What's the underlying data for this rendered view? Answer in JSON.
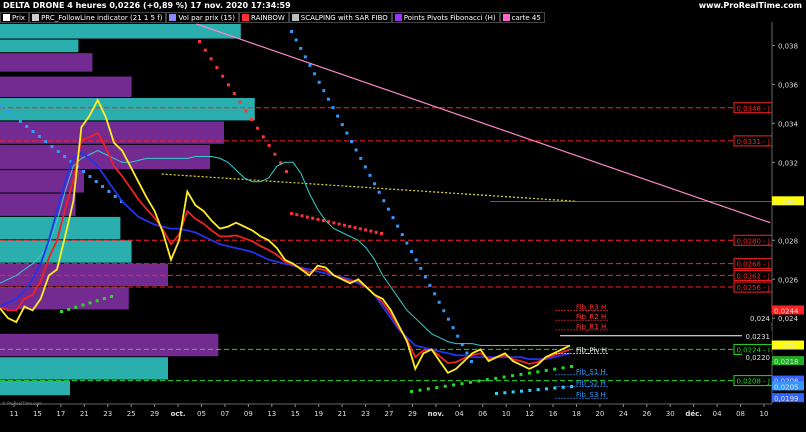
{
  "header": {
    "title": "DELTA DRONE 4 heures 0,0226 (+0,89 %) 17 nov. 2020 17:34:59",
    "brand": "www.ProRealTime.com"
  },
  "legend": [
    {
      "label": "Prix",
      "color": "#ffffff"
    },
    {
      "label": "PRC_FollowLine indicator (21 1 5 f)",
      "color": "#cccccc"
    },
    {
      "label": "Vol par prix (15)",
      "color": "#8888ff"
    },
    {
      "label": "RAINBOW",
      "color": "#ff3333"
    },
    {
      "label": "SCALPING with SAR FIBO",
      "color": "#bbbbbb"
    },
    {
      "label": "Points Pivots Fibonacci (H)",
      "color": "#9933ff"
    },
    {
      "label": "carte 45",
      "color": "#ff66cc"
    }
  ],
  "footer": "© ProRealTime.com",
  "colors": {
    "background": "#000000",
    "red_dash": "#ff2020",
    "green_dash": "#22dd22",
    "blue_dots": "#3399ff",
    "pink_trend": "#ff88cc",
    "yellow_dots": "#dddd33",
    "volume_cyan": "#33cccc",
    "volume_purple": "#8833aa"
  },
  "chart_data": {
    "type": "line",
    "title": "DELTA DRONE 4 heures",
    "ylim": [
      0.0196,
      0.0392
    ],
    "y_ticks": [
      "0,038",
      "0,036",
      "0,034",
      "0,032",
      "0,030",
      "0,028",
      "0,026",
      "0,024"
    ],
    "x_ticks": [
      "11",
      "15",
      "17",
      "21",
      "23",
      "25",
      "29",
      "oct.",
      "05",
      "07",
      "09",
      "13",
      "15",
      "19",
      "21",
      "23",
      "27",
      "29",
      "nov.",
      "04",
      "06",
      "10",
      "12",
      "16",
      "18",
      "20",
      "24",
      "26",
      "30",
      "déc.",
      "04",
      "08",
      "10"
    ],
    "red_levels": [
      {
        "label": "0,0348 - J",
        "value": 0.0348
      },
      {
        "label": "0,0331 - J",
        "value": 0.0331
      },
      {
        "label": "0,0280 - J",
        "value": 0.028
      },
      {
        "label": "0,0268 - J",
        "value": 0.0268
      },
      {
        "label": "0,0262 - J",
        "value": 0.0262
      },
      {
        "label": "0,0256 - J",
        "value": 0.0256
      }
    ],
    "green_levels": [
      {
        "label": "0,0224 - J",
        "value": 0.0224
      },
      {
        "label": "0,0208 - J",
        "value": 0.0208
      }
    ],
    "price_tags": [
      {
        "label": "0,0300",
        "value": 0.03,
        "bg": "#ffff00",
        "fg": "#000000"
      },
      {
        "label": "0,0244",
        "value": 0.0244,
        "bg": "#ff2020",
        "fg": "#ffffff"
      },
      {
        "label": "0,024",
        "value": 0.024,
        "bg": "#000000",
        "fg": "#ffffff"
      },
      {
        "label": "0,0231",
        "value": 0.0231,
        "bg": "#000000",
        "fg": "#ffffff"
      },
      {
        "label": "0,0226",
        "value": 0.0226,
        "bg": "#ffff00",
        "fg": "#000000"
      },
      {
        "label": "0,0220",
        "value": 0.022,
        "bg": "#000000",
        "fg": "#ffffff"
      },
      {
        "label": "0,0218",
        "value": 0.0218,
        "bg": "#22aa22",
        "fg": "#ffffff"
      },
      {
        "label": "0,0208",
        "value": 0.0208,
        "bg": "#3366ff",
        "fg": "#ffffff"
      },
      {
        "label": "0,0205",
        "value": 0.0205,
        "bg": "#3399ff",
        "fg": "#ffffff"
      },
      {
        "label": "0,0199",
        "value": 0.0199,
        "bg": "#3366ff",
        "fg": "#ffffff"
      }
    ],
    "fib_labels": [
      {
        "label": "Fib_R3 H",
        "value": 0.0244,
        "color": "#ff3333"
      },
      {
        "label": "Fib_R2 H",
        "value": 0.0239,
        "color": "#ff3333"
      },
      {
        "label": "Fib_R1 H",
        "value": 0.0234,
        "color": "#ff3333"
      },
      {
        "label": "Fib_Piv H",
        "value": 0.0222,
        "color": "#ffffff"
      },
      {
        "label": "Fib_S1 H",
        "value": 0.0211,
        "color": "#3399ff"
      },
      {
        "label": "Fib_S2 H",
        "value": 0.0205,
        "color": "#3399ff"
      },
      {
        "label": "Fib_S3 H",
        "value": 0.0199,
        "color": "#3399ff"
      }
    ],
    "volume_profile": [
      {
        "y_top": 0.0391,
        "y_bot": 0.0383,
        "v": 0.86,
        "c": "cyan"
      },
      {
        "y_top": 0.0383,
        "y_bot": 0.0376,
        "v": 0.28,
        "c": "cyan"
      },
      {
        "y_top": 0.0376,
        "y_bot": 0.0366,
        "v": 0.33,
        "c": "purple"
      },
      {
        "y_top": 0.0364,
        "y_bot": 0.0353,
        "v": 0.47,
        "c": "purple"
      },
      {
        "y_top": 0.0353,
        "y_bot": 0.0341,
        "v": 0.91,
        "c": "cyan"
      },
      {
        "y_top": 0.0341,
        "y_bot": 0.0329,
        "v": 0.8,
        "c": "purple"
      },
      {
        "y_top": 0.0329,
        "y_bot": 0.0316,
        "v": 0.75,
        "c": "purple"
      },
      {
        "y_top": 0.0316,
        "y_bot": 0.0304,
        "v": 0.3,
        "c": "purple"
      },
      {
        "y_top": 0.0304,
        "y_bot": 0.0292,
        "v": 0.27,
        "c": "purple"
      },
      {
        "y_top": 0.0292,
        "y_bot": 0.028,
        "v": 0.43,
        "c": "cyan"
      },
      {
        "y_top": 0.028,
        "y_bot": 0.0268,
        "v": 0.47,
        "c": "cyan"
      },
      {
        "y_top": 0.0268,
        "y_bot": 0.0256,
        "v": 0.6,
        "c": "purple"
      },
      {
        "y_top": 0.0256,
        "y_bot": 0.0244,
        "v": 0.46,
        "c": "purple"
      },
      {
        "y_top": 0.0232,
        "y_bot": 0.022,
        "v": 0.78,
        "c": "purple"
      },
      {
        "y_top": 0.022,
        "y_bot": 0.0208,
        "v": 0.6,
        "c": "cyan"
      },
      {
        "y_top": 0.0208,
        "y_bot": 0.02,
        "v": 0.25,
        "c": "cyan"
      }
    ],
    "price_line": [
      0.0245,
      0.024,
      0.0238,
      0.0246,
      0.0244,
      0.025,
      0.0262,
      0.0265,
      0.0282,
      0.03,
      0.0338,
      0.0344,
      0.0352,
      0.0343,
      0.033,
      0.0326,
      0.0318,
      0.031,
      0.0302,
      0.0295,
      0.0284,
      0.027,
      0.028,
      0.0305,
      0.0298,
      0.0295,
      0.029,
      0.0286,
      0.0287,
      0.0289,
      0.0287,
      0.0285,
      0.0282,
      0.028,
      0.0276,
      0.027,
      0.0268,
      0.0265,
      0.0262,
      0.0267,
      0.0266,
      0.0262,
      0.026,
      0.0258,
      0.026,
      0.0256,
      0.0252,
      0.025,
      0.0244,
      0.0236,
      0.0228,
      0.0214,
      0.0222,
      0.0224,
      0.0218,
      0.0212,
      0.0214,
      0.0218,
      0.0222,
      0.0224,
      0.0218,
      0.022,
      0.0222,
      0.0218,
      0.0216,
      0.0214,
      0.0216,
      0.022,
      0.0222,
      0.0224,
      0.0226
    ],
    "slow_line": [
      0.0246,
      0.0248,
      0.025,
      0.0254,
      0.026,
      0.0268,
      0.028,
      0.0295,
      0.031,
      0.0322,
      0.0325,
      0.0322,
      0.0318,
      0.0312,
      0.0306,
      0.03,
      0.0296,
      0.0292,
      0.029,
      0.0288,
      0.0287,
      0.0286,
      0.0286,
      0.0285,
      0.0284,
      0.0282,
      0.028,
      0.0278,
      0.0277,
      0.0276,
      0.0275,
      0.0274,
      0.0272,
      0.027,
      0.0269,
      0.0268,
      0.0267,
      0.0266,
      0.0265,
      0.0264,
      0.0263,
      0.0262,
      0.0261,
      0.026,
      0.0258,
      0.0256,
      0.0252,
      0.0246,
      0.024,
      0.0234,
      0.023,
      0.0226,
      0.0225,
      0.0224,
      0.0223,
      0.0222,
      0.0221,
      0.0221,
      0.022,
      0.022,
      0.022,
      0.022,
      0.022,
      0.022,
      0.022,
      0.0219,
      0.0219,
      0.0219,
      0.022,
      0.0221,
      0.0222
    ],
    "cyan_line": [
      0.0258,
      0.026,
      0.0262,
      0.0265,
      0.0268,
      0.0272,
      0.0278,
      0.029,
      0.0305,
      0.0318,
      0.0322,
      0.0324,
      0.0326,
      0.0324,
      0.0322,
      0.032,
      0.032,
      0.0321,
      0.0322,
      0.0322,
      0.0322,
      0.0322,
      0.0322,
      0.0322,
      0.0323,
      0.0323,
      0.0323,
      0.0322,
      0.032,
      0.0316,
      0.0312,
      0.031,
      0.031,
      0.0312,
      0.0318,
      0.032,
      0.032,
      0.0314,
      0.0304,
      0.0296,
      0.029,
      0.0286,
      0.0284,
      0.0282,
      0.028,
      0.0276,
      0.027,
      0.0262,
      0.0256,
      0.025,
      0.0244,
      0.024,
      0.0236,
      0.0232,
      0.023,
      0.0228,
      0.0227,
      0.0227,
      0.0227,
      0.0226,
      0.0226,
      0.0226,
      0.0226,
      0.0226,
      0.0226,
      0.0226,
      0.0226,
      0.0226,
      0.0226,
      0.0226,
      0.0226
    ],
    "trend_line": {
      "from": [
        0.0391,
        0.255
      ],
      "to": [
        0.0289,
        0.955
      ]
    },
    "yellow_dotted": {
      "from": [
        0.0314,
        0.21
      ],
      "to": [
        0.03,
        0.71
      ]
    }
  }
}
